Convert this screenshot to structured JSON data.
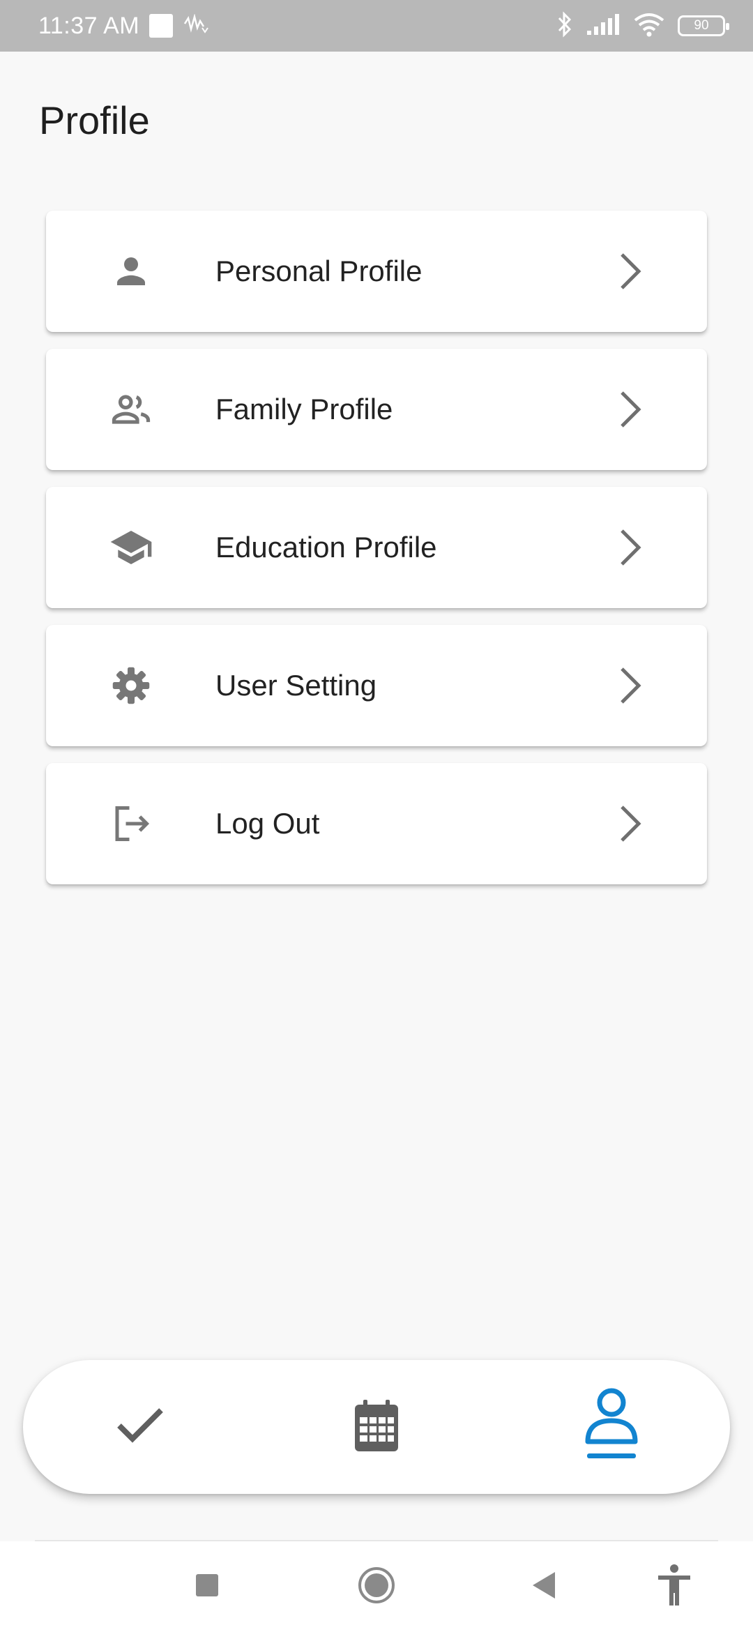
{
  "status_bar": {
    "time": "11:37 AM",
    "battery": "90",
    "icons": [
      "notification-square-icon",
      "signal-wave-icon",
      "bluetooth-icon",
      "cell-signal-icon",
      "wifi-icon",
      "battery-icon"
    ]
  },
  "page": {
    "title": "Profile"
  },
  "menu": {
    "items": [
      {
        "label": "Personal Profile",
        "icon": "person-icon"
      },
      {
        "label": "Family Profile",
        "icon": "people-icon"
      },
      {
        "label": "Education Profile",
        "icon": "graduation-cap-icon"
      },
      {
        "label": "User Setting",
        "icon": "gear-icon"
      },
      {
        "label": "Log Out",
        "icon": "logout-icon"
      }
    ]
  },
  "bottom_nav": {
    "items": [
      {
        "name": "tasks",
        "icon": "check-icon",
        "active": false
      },
      {
        "name": "calendar",
        "icon": "calendar-icon",
        "active": false
      },
      {
        "name": "profile",
        "icon": "profile-icon",
        "active": true
      }
    ],
    "active_color": "#1284d0",
    "inactive_color": "#5f5f5f"
  },
  "system_nav": {
    "icons": [
      "recents-square-icon",
      "home-circle-icon",
      "back-triangle-icon",
      "accessibility-icon"
    ]
  }
}
